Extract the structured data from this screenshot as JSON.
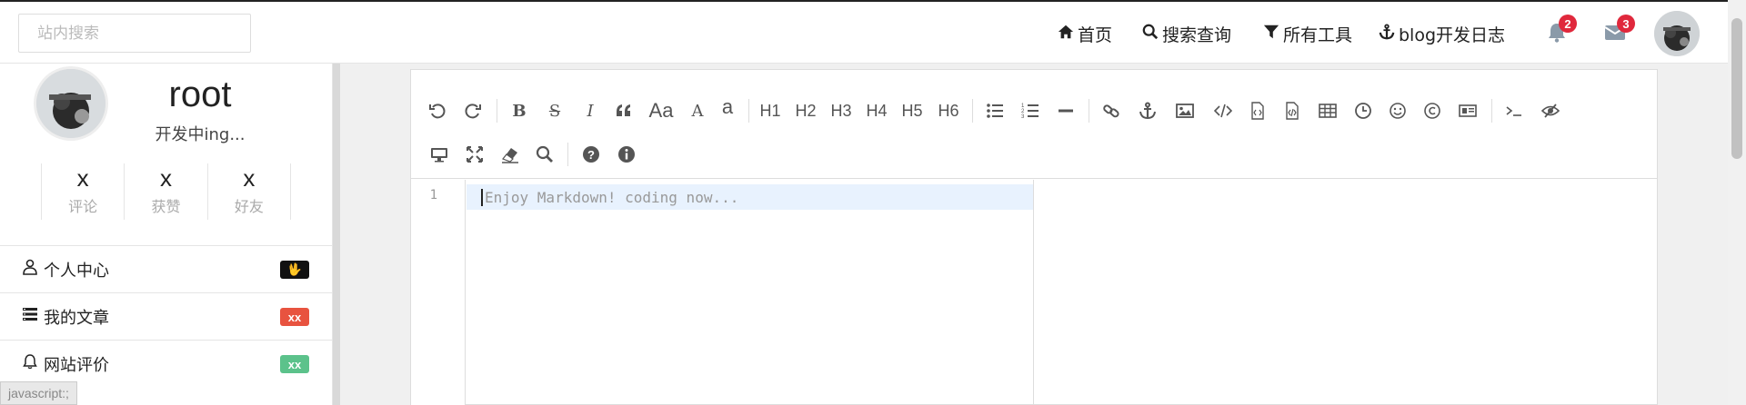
{
  "search": {
    "placeholder": "站内搜索"
  },
  "nav": {
    "items": [
      {
        "label": "首页",
        "icon": "home-icon"
      },
      {
        "label": "搜索查询",
        "icon": "search-icon"
      },
      {
        "label": "所有工具",
        "icon": "filter-icon"
      },
      {
        "label": "blog开发日志",
        "icon": "anchor-icon"
      }
    ],
    "notifications": {
      "count": "2",
      "icon": "bell-icon"
    },
    "messages": {
      "count": "3",
      "icon": "envelope-icon"
    },
    "avatar_icon": "avatar"
  },
  "profile": {
    "name": "root",
    "status": "开发中ing...",
    "stats": [
      {
        "value": "x",
        "label": "评论"
      },
      {
        "value": "x",
        "label": "获赞"
      },
      {
        "value": "x",
        "label": "好友"
      }
    ]
  },
  "menu": [
    {
      "label": "个人中心",
      "icon": "user-icon",
      "badge": "🖖",
      "badge_color": "#111111"
    },
    {
      "label": "我的文章",
      "icon": "list-icon",
      "badge": "xx",
      "badge_color": "#e8533f"
    },
    {
      "label": "网站评价",
      "icon": "bell-icon",
      "badge": "xx",
      "badge_color": "#5cc28b"
    }
  ],
  "editor": {
    "line_number": "1",
    "placeholder": "Enjoy Markdown! coding now...",
    "toolbar_headings": [
      "H1",
      "H2",
      "H3",
      "H4",
      "H5",
      "H6"
    ],
    "toolbar_text": {
      "case": "Aa",
      "upper": "A",
      "lower": "a"
    }
  },
  "status_hint": "javascript:;"
}
